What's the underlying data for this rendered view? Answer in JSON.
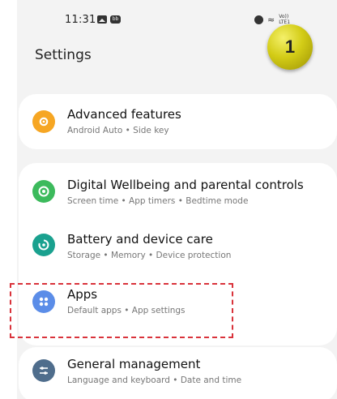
{
  "status_bar": {
    "time": "11:31",
    "message_badge": "bb",
    "volte_top": "Vo))",
    "volte_bottom": "LTE1",
    "icons": [
      "gallery-icon",
      "message-icon",
      "alarm-icon",
      "wifi-icon"
    ]
  },
  "header": {
    "title": "Settings"
  },
  "annotation": {
    "step_number": "1",
    "badge_color": "#d3cc16",
    "highlight_color": "#d9333b"
  },
  "settings": {
    "advanced": {
      "title": "Advanced features",
      "subtitle": "Android Auto • Side key",
      "icon": "advanced-features-icon",
      "color": "#f6a623"
    },
    "wellbeing": {
      "title": "Digital Wellbeing and parental controls",
      "subtitle": "Screen time • App timers • Bedtime mode",
      "icon": "digital-wellbeing-icon",
      "color": "#3cba5c"
    },
    "battery": {
      "title": "Battery and device care",
      "subtitle": "Storage • Memory • Device protection",
      "icon": "device-care-icon",
      "color": "#1aa18f"
    },
    "apps": {
      "title": "Apps",
      "subtitle": "Default apps • App settings",
      "icon": "apps-icon",
      "color": "#5b8de8"
    },
    "general": {
      "title": "General management",
      "subtitle": "Language and keyboard • Date and time",
      "icon": "general-management-icon",
      "color": "#4f6d8c"
    }
  }
}
